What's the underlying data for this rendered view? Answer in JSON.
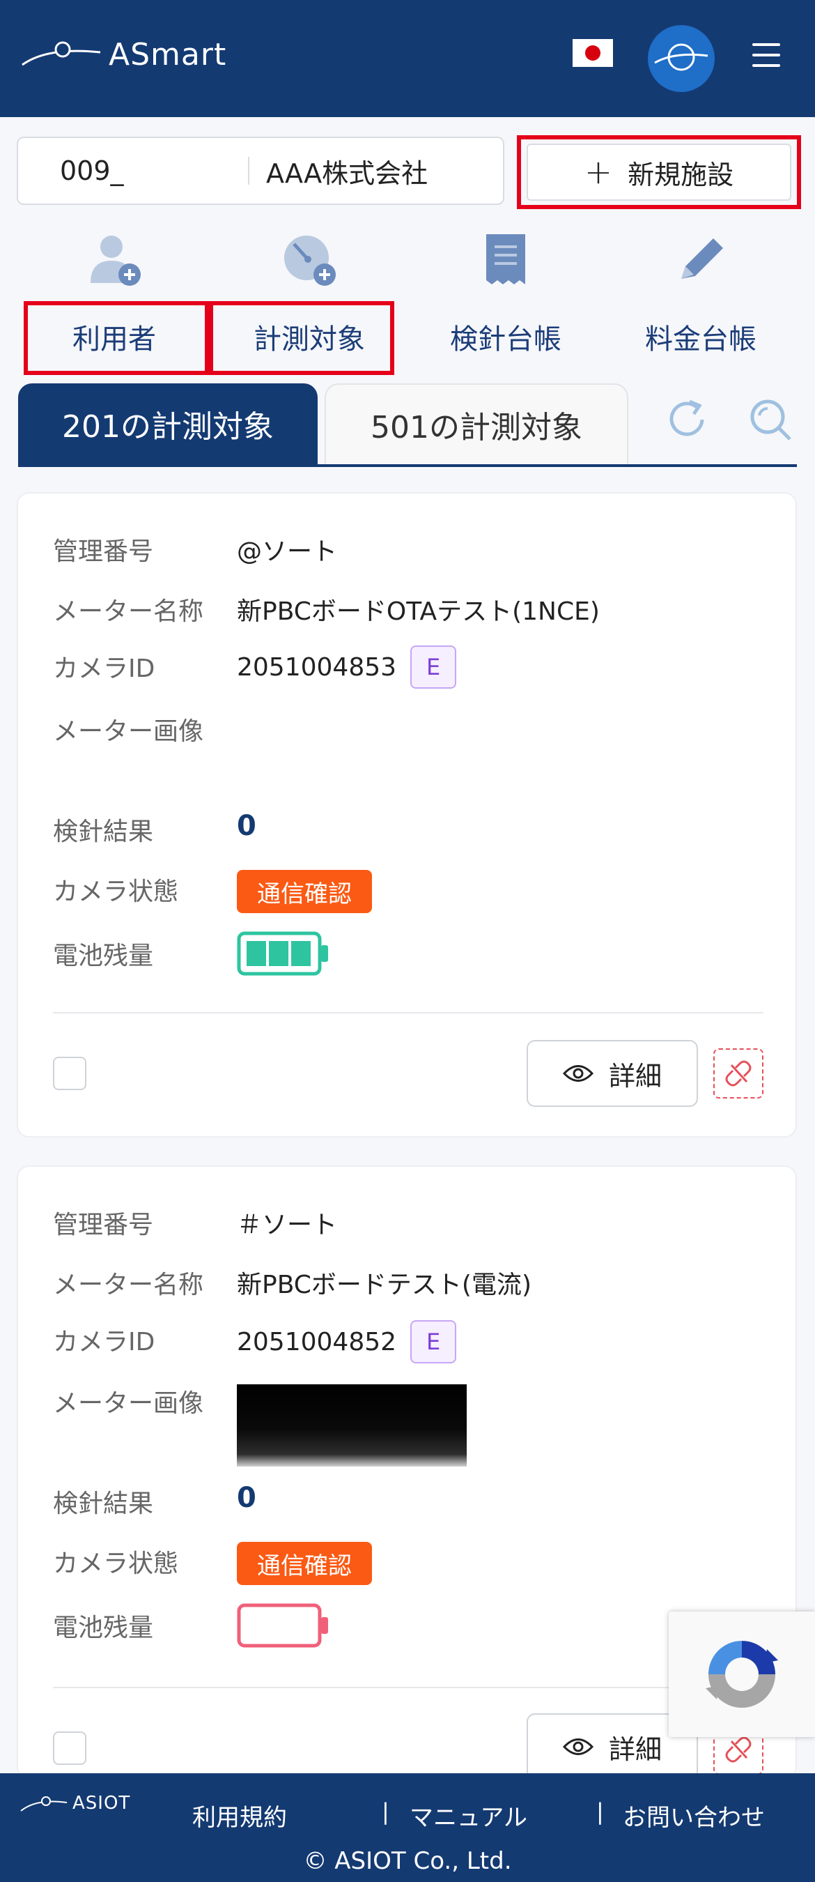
{
  "header": {
    "app_name": "ASmart",
    "language_flag": "japan-flag-icon",
    "colors": {
      "primary": "#143a72",
      "accent": "#1f6ec7"
    }
  },
  "facility": {
    "code": "009_",
    "name": "AAA株式会社",
    "new_facility_label": "新規施設"
  },
  "nav": {
    "items": [
      {
        "label": "利用者",
        "icon": "add-user-icon"
      },
      {
        "label": "計測対象",
        "icon": "add-gauge-icon"
      },
      {
        "label": "検針台帳",
        "icon": "receipt-icon"
      },
      {
        "label": "料金台帳",
        "icon": "pencil-icon"
      }
    ]
  },
  "tabs": {
    "active": "201の計測対象",
    "inactive": "501の計測対象"
  },
  "labels": {
    "management_number": "管理番号",
    "meter_name": "メーター名称",
    "camera_id": "カメラID",
    "meter_image": "メーター画像",
    "reading_result": "検針結果",
    "camera_status": "カメラ状態",
    "battery": "電池残量",
    "detail": "詳細"
  },
  "cards": [
    {
      "management_number": "@ソート",
      "meter_name": "新PBCボードOTAテスト(1NCE)",
      "camera_id": "2051004853",
      "camera_badge": "E",
      "reading_result": "0",
      "camera_status": "通信確認",
      "battery_level": 1.0,
      "battery_color": "#2ec4a0"
    },
    {
      "management_number": "＃ソート",
      "meter_name": "新PBCボードテスト(電流)",
      "camera_id": "2051004852",
      "camera_badge": "E",
      "reading_result": "0",
      "camera_status": "通信確認",
      "battery_level": 0.0,
      "battery_color": "#f0607a"
    }
  ],
  "footer": {
    "logo": "ASIOT",
    "links": [
      "利用規約",
      "マニュアル",
      "お問い合わせ"
    ],
    "separator": "|",
    "copyright": "© ASIOT Co., Ltd."
  }
}
